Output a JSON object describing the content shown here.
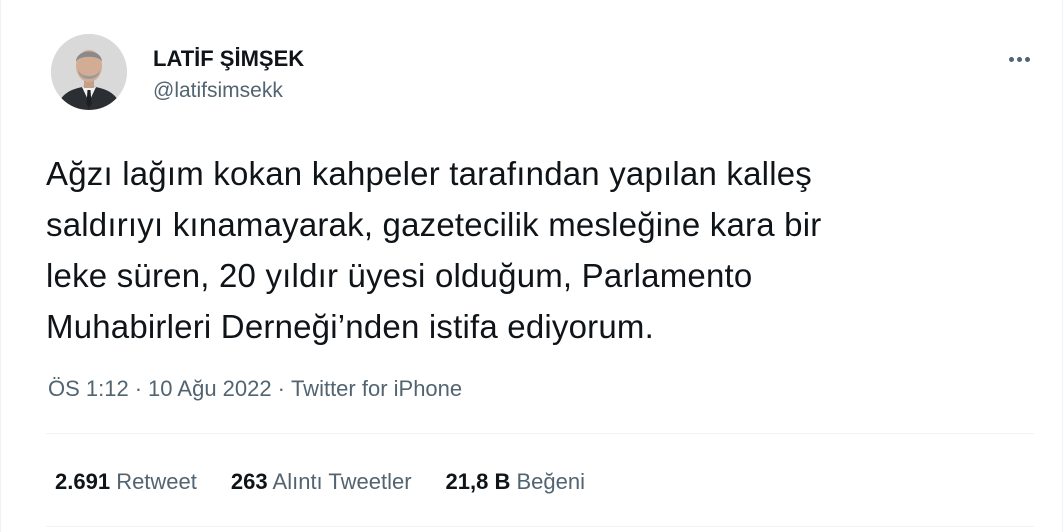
{
  "author": {
    "display_name": "LATİF ŞİMŞEK",
    "handle": "@latifsimsekk",
    "avatar_icon": "profile-photo"
  },
  "more_icon": "more-horizontal-icon",
  "tweet": {
    "lines": [
      "Ağzı lağım kokan kahpeler tarafından yapılan kalleş",
      "saldırıyı kınamayarak, gazetecilik mesleğine kara bir",
      "leke süren, 20 yıldır üyesi olduğum, Parlamento",
      "Muhabirleri Derneği’nden istifa ediyorum."
    ]
  },
  "meta": {
    "time": "ÖS 1:12",
    "separator": "·",
    "date": "10 Ağu 2022",
    "source": "Twitter for iPhone"
  },
  "stats": {
    "retweets": {
      "count": "2.691",
      "label": "Retweet"
    },
    "quotes": {
      "count": "263",
      "label": "Alıntı Tweetler"
    },
    "likes": {
      "count": "21,8 B",
      "label": "Beğeni"
    }
  },
  "colors": {
    "text_primary": "#0f1419",
    "text_secondary": "#536471",
    "divider": "#eff3f4"
  }
}
